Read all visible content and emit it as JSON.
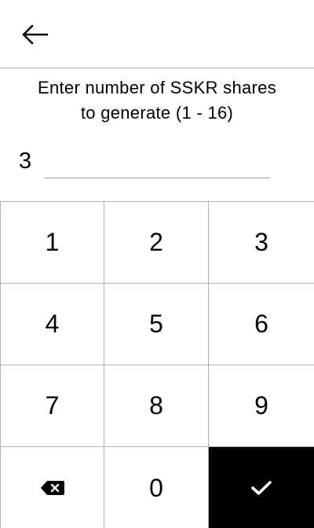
{
  "header": {
    "back_icon": "arrow-left-icon"
  },
  "prompt": {
    "line1": "Enter number of SSKR shares",
    "line2": "to generate (1 - 16)"
  },
  "entry": {
    "value": "3"
  },
  "keypad": {
    "keys": [
      "1",
      "2",
      "3",
      "4",
      "5",
      "6",
      "7",
      "8",
      "9"
    ],
    "zero": "0",
    "delete_icon": "backspace-icon",
    "confirm_icon": "checkmark-icon"
  },
  "colors": {
    "confirm_background": "#000000",
    "divider": "#b0b0b0"
  }
}
